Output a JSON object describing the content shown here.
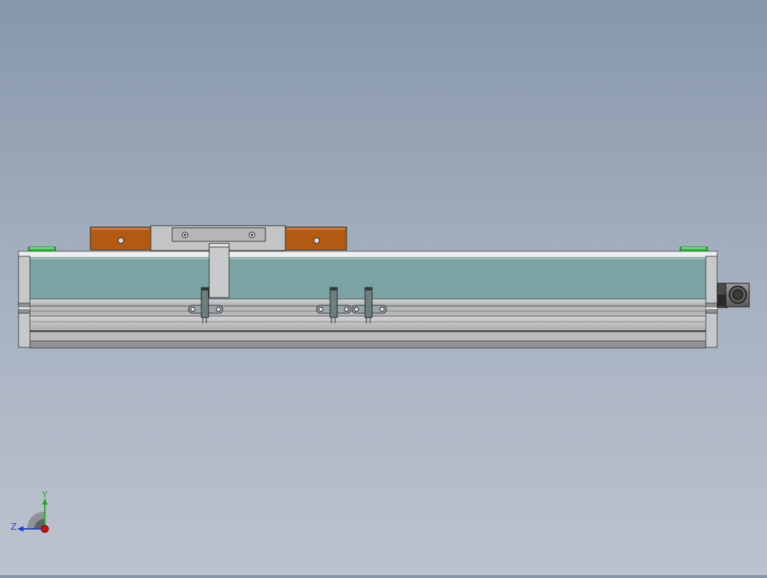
{
  "viewport": {
    "background_top": "#8796aa",
    "background_bottom": "#bcc3ce"
  },
  "model": {
    "colors": {
      "rail_cover": "#7aa3a3",
      "profile": "#b7b9bb",
      "profile_dark": "#8f9193",
      "end_cap": "#c6c8ca",
      "block_orange": "#b35a12",
      "plate_grey": "#c2c4c6",
      "end_stop_green": "#27b33a",
      "sensor_grey": "#6f7f80",
      "motor_dark": "#3a3a3a"
    },
    "sensor_count": 3,
    "end_stop_count": 2
  },
  "triad": {
    "y_label": "Y",
    "z_label": "Z",
    "y_color": "#22aa22",
    "z_color": "#1f3fd0",
    "origin_color": "#d01010"
  }
}
